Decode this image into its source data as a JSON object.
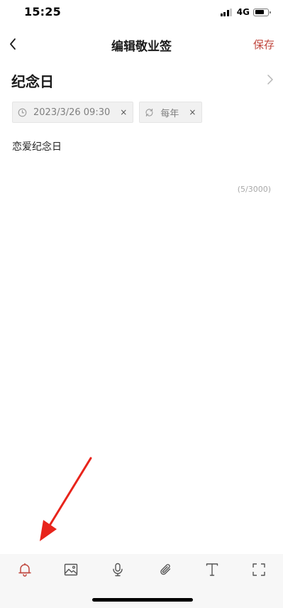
{
  "status_bar": {
    "time": "15:25",
    "network": "4G"
  },
  "nav": {
    "title": "编辑敬业签",
    "save_label": "保存"
  },
  "note": {
    "title": "纪念日",
    "tags": [
      {
        "icon": "clock-icon",
        "label": "2023/3/26 09:30",
        "close": "×"
      },
      {
        "icon": "repeat-icon",
        "label": "每年",
        "close": "×"
      }
    ],
    "body": "恋爱纪念日",
    "char_count": "(5/3000)"
  },
  "toolbar": {
    "items": [
      "bell-icon",
      "image-icon",
      "microphone-icon",
      "paperclip-icon",
      "text-format-icon",
      "fullscreen-icon"
    ],
    "active_item": "bell-icon"
  },
  "colors": {
    "accent": "#c0473e",
    "annotation_arrow": "#e8241b",
    "toolbar_background": "#f7f7f7",
    "tag_background": "#f1f1f1"
  }
}
